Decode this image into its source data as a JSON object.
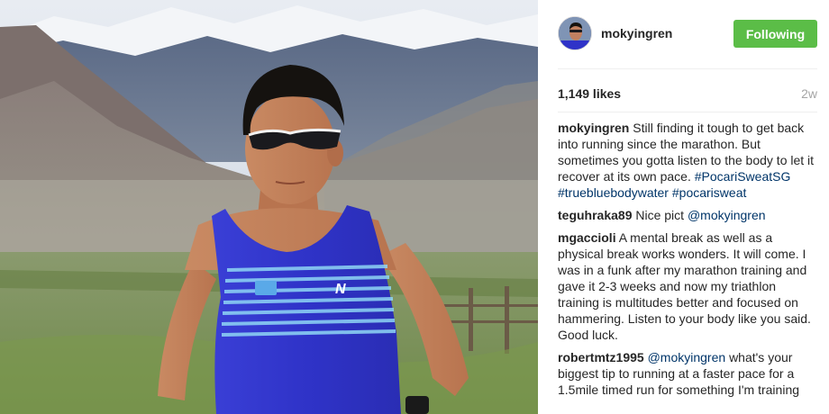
{
  "post": {
    "username": "mokyingren",
    "follow_label": "Following",
    "likes": "1,149 likes",
    "time_ago": "2w"
  },
  "caption": {
    "author": "mokyingren",
    "text": "Still finding it tough to get back into running since the marathon. But sometimes you gotta listen to the body to let it recover at its own pace.",
    "hashtags": [
      "#PocariSweatSG",
      "#truebluebodywater",
      "#pocarisweat"
    ]
  },
  "comments": [
    {
      "author": "teguhraka89",
      "text": "Nice pict",
      "mention": "@mokyingren",
      "after": ""
    },
    {
      "author": "mgaccioli",
      "text": "A mental break as well as a physical break works wonders. It will come. I was in a funk after my marathon training and gave it 2-3 weeks and now my triathlon training is multitudes better and focused on hammering. Listen to your body like you said. Good luck.",
      "mention": "",
      "after": ""
    },
    {
      "author": "robertmtz1995",
      "text": "",
      "mention": "@mokyingren",
      "after": "what's your biggest tip to running at a faster pace for a 1.5mile timed run for something I'm training"
    }
  ],
  "colors": {
    "follow_button": "#5bbd47",
    "link": "#003569",
    "meta_gray": "#a5a5a5",
    "shirt_blue": "#2f33c8"
  },
  "icons": {
    "avatar": "runner-portrait"
  }
}
